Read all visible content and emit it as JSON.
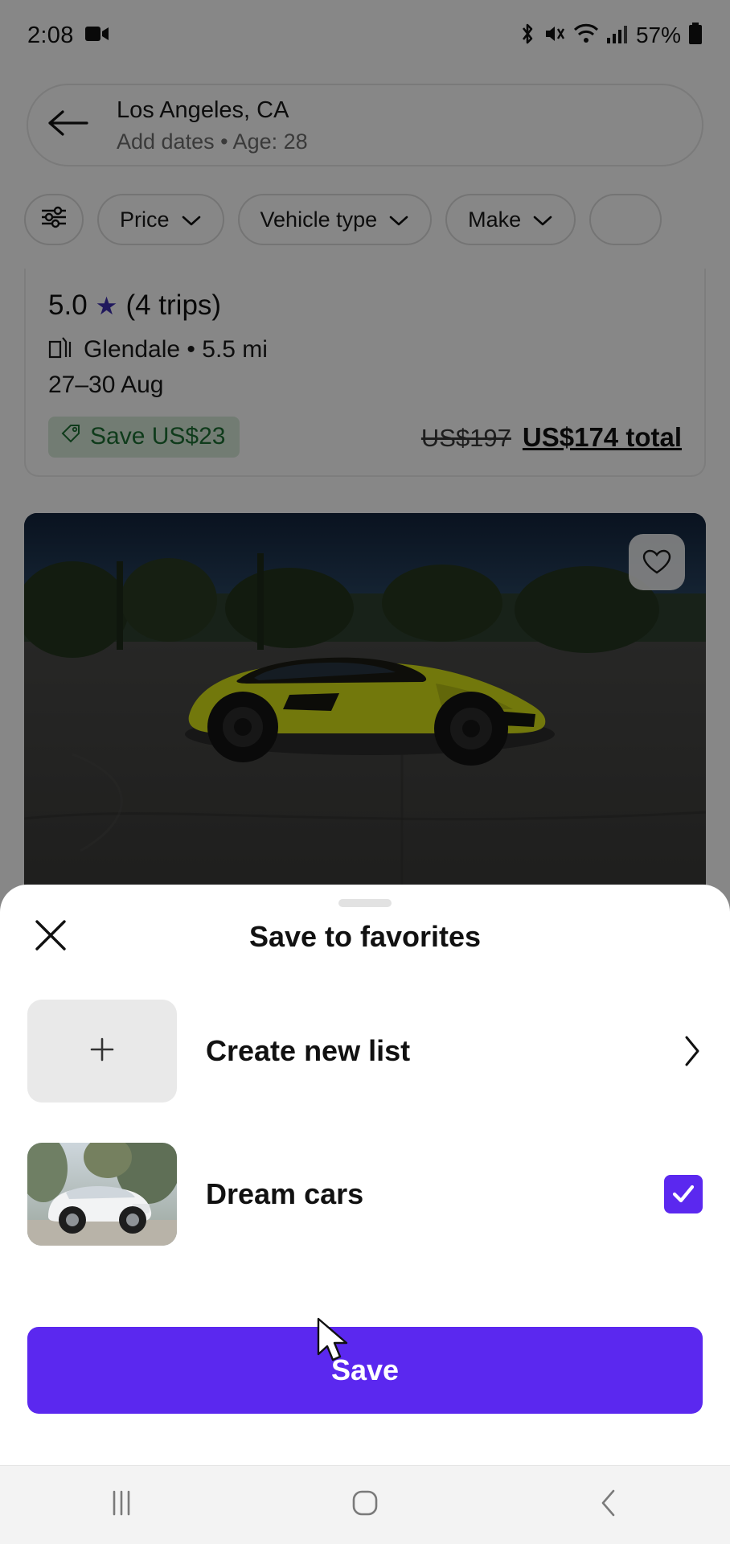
{
  "status_bar": {
    "time": "2:08",
    "battery_percent": "57%",
    "icons": [
      "video-camera-icon",
      "bluetooth-icon",
      "mute-icon",
      "wifi-icon",
      "cellular-signal-icon",
      "battery-icon"
    ]
  },
  "search_header": {
    "back_icon": "arrow-left-icon",
    "location": "Los Angeles, CA",
    "subtitle": "Add dates • Age: 28"
  },
  "filters": {
    "settings_icon": "filter-sliders-icon",
    "chips": [
      {
        "label": "Price",
        "icon": "chevron-down-icon"
      },
      {
        "label": "Vehicle type",
        "icon": "chevron-down-icon"
      },
      {
        "label": "Make",
        "icon": "chevron-down-icon"
      },
      {
        "label": "",
        "icon": ""
      }
    ]
  },
  "listing": {
    "rating": "5.0",
    "star_icon": "star-icon",
    "trips": "(4 trips)",
    "location_icon": "car-location-icon",
    "location": "Glendale • 5.5 mi",
    "dates": "27–30 Aug",
    "save_badge_icon": "tag-icon",
    "save_badge": "Save US$23",
    "price_original": "US$197",
    "price_total": "US$174 total",
    "favorite_icon": "heart-icon"
  },
  "sheet": {
    "close_icon": "close-icon",
    "title": "Save to favorites",
    "rows": [
      {
        "label": "Create new list",
        "leading_icon": "plus-icon",
        "trailing_icon": "chevron-right-icon",
        "checked": false
      },
      {
        "label": "Dream cars",
        "leading_icon": "list-thumbnail-image",
        "trailing_icon": "checkbox-checked-icon",
        "checked": true
      }
    ],
    "save_label": "Save"
  },
  "nav_bar": {
    "recents_icon": "recents-icon",
    "home_icon": "home-icon",
    "back_icon": "back-icon"
  },
  "colors": {
    "accent_purple": "#5b28ef",
    "star_purple": "#3d2fb0",
    "badge_green_text": "#1d7034",
    "badge_green_bg": "#d8ead9",
    "sheet_white": "#ffffff",
    "nav_bar_bg": "#f3f3f3"
  },
  "cursor": {
    "type": "arrow-pointer"
  }
}
